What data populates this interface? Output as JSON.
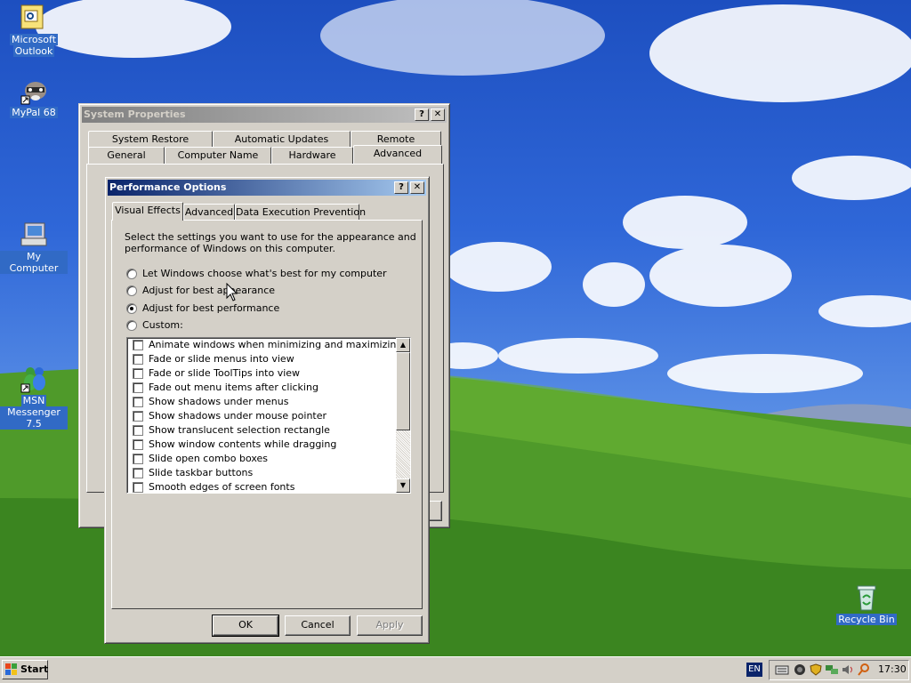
{
  "desktop_icons": [
    {
      "id": "outlook",
      "label_line1": "Microsoft",
      "label_line2": "Outlook",
      "icon": "outlook-icon",
      "selected": true
    },
    {
      "id": "mypal",
      "label_line1": "MyPal 68",
      "label_line2": "",
      "icon": "raccoon-icon",
      "selected": false
    },
    {
      "id": "mycomputer",
      "label_line1": "My Computer",
      "label_line2": "",
      "icon": "computer-icon",
      "selected": true
    },
    {
      "id": "msn",
      "label_line1": "MSN",
      "label_line2": "Messenger 7.5",
      "icon": "msn-butterfly-icon",
      "selected": true
    },
    {
      "id": "recycle",
      "label_line1": "Recycle Bin",
      "label_line2": "",
      "icon": "recycle-bin-icon",
      "selected": true
    }
  ],
  "system_properties": {
    "title": "System Properties",
    "help_glyph": "?",
    "close_glyph": "✕",
    "tabs_row1": [
      "System Restore",
      "Automatic Updates",
      "Remote"
    ],
    "tabs_row2": [
      "General",
      "Computer Name",
      "Hardware",
      "Advanced"
    ],
    "active_tab": "Advanced"
  },
  "performance_options": {
    "title": "Performance Options",
    "help_glyph": "?",
    "close_glyph": "✕",
    "tabs": [
      "Visual Effects",
      "Advanced",
      "Data Execution Prevention"
    ],
    "active_tab": "Visual Effects",
    "description": "Select the settings you want to use for the appearance and performance of Windows on this computer.",
    "description_line1": "Select the settings you want to use for the appearance and",
    "description_line2": "performance of Windows on this computer.",
    "options": [
      {
        "label": "Let Windows choose what's best for my computer",
        "checked": false
      },
      {
        "label": "Adjust for best appearance",
        "checked": false
      },
      {
        "label": "Adjust for best performance",
        "checked": true
      },
      {
        "label": "Custom:",
        "checked": false
      }
    ],
    "effects": [
      {
        "label": "Animate windows when minimizing and maximizing",
        "checked": false
      },
      {
        "label": "Fade or slide menus into view",
        "checked": false
      },
      {
        "label": "Fade or slide ToolTips into view",
        "checked": false
      },
      {
        "label": "Fade out menu items after clicking",
        "checked": false
      },
      {
        "label": "Show shadows under menus",
        "checked": false
      },
      {
        "label": "Show shadows under mouse pointer",
        "checked": false
      },
      {
        "label": "Show translucent selection rectangle",
        "checked": false
      },
      {
        "label": "Show window contents while dragging",
        "checked": false
      },
      {
        "label": "Slide open combo boxes",
        "checked": false
      },
      {
        "label": "Slide taskbar buttons",
        "checked": false
      },
      {
        "label": "Smooth edges of screen fonts",
        "checked": false
      }
    ],
    "buttons": {
      "ok": "OK",
      "cancel": "Cancel",
      "apply": "Apply"
    }
  },
  "taskbar": {
    "start_label": "Start",
    "language": "EN",
    "clock": "17:30",
    "tray_icons": [
      "keyboard-icon",
      "security-icon",
      "shield-icon",
      "network-icon",
      "volume-icon",
      "search-icon"
    ]
  }
}
